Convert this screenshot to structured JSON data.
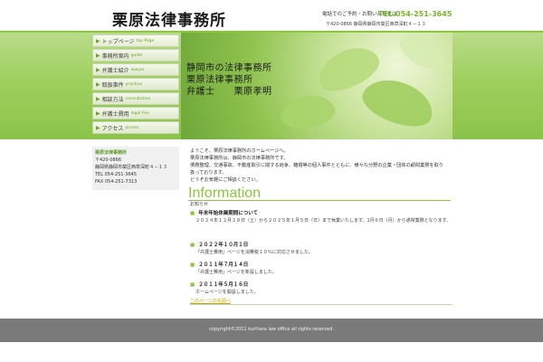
{
  "header": {
    "site_title": "栗原法律事務所",
    "contact_label": "電話でのご予約・お問い合わせは",
    "tel": "TEL.054-251-3645",
    "address": "〒420-0866 静岡県静岡市葵区西草深町４－１３"
  },
  "hero": {
    "line1": "静岡市の法律事務所",
    "line2": "栗原法律事務所",
    "line3": "弁護士　　栗原孝明"
  },
  "nav": [
    {
      "jp": "トップページ",
      "en": "top Page"
    },
    {
      "jp": "事務所案内",
      "en": "guide"
    },
    {
      "jp": "弁護士紹介",
      "en": "lawyer"
    },
    {
      "jp": "取扱事件",
      "en": "practice"
    },
    {
      "jp": "相談方法",
      "en": "consultation"
    },
    {
      "jp": "弁護士費用",
      "en": "legal Fee"
    },
    {
      "jp": "アクセス",
      "en": "access"
    }
  ],
  "sidebox": {
    "title": "栗原法律事務所",
    "zip": "〒420-0866",
    "address": "静岡県静岡市葵区西草深町４－１３",
    "tel": "TEL 054-251-3645",
    "fax": "FAX 054-251-7313"
  },
  "intro": {
    "line1": "ようこそ、栗原法律事務所のホームページへ。",
    "line2": "栗原法律事務所は、静岡市の法律事務所です。",
    "line3": "債務整理、交通事故、不動産取引に関する紛争、離婚等の個人事件とともに、様々な分野の企業・団体の顧問業務を取り扱っております。",
    "line4": "どうぞお気軽にご相談ください。"
  },
  "info": {
    "heading": "Information",
    "sub": "お知らせ",
    "items": [
      {
        "title": "年末年始休業期間について",
        "body": "２０２４年１２月２８日（土）から２０２５年１月５日（日）まで休業いたします。1月６日（月）から通常業務となります。"
      },
      {
        "title": "２０２２年１０月１日",
        "body": "「弁護士費用」ページを消費税１０％に対応させました。"
      },
      {
        "title": "２０１１年７月１４日",
        "body": "「弁護士費用」ページを新設しました。"
      },
      {
        "title": "２０１１年５月１６日",
        "body": "ホームページを開設しました。"
      }
    ],
    "to_list": "このページの先頭へ"
  },
  "footer": {
    "copyright": "copyright©2011 kurihara law office all rights reserved."
  },
  "colors": {
    "accent": "#8cc63f",
    "footer": "#7a7a7a",
    "link": "#c8a000"
  },
  "icons": {
    "nav": "arrow-right-icon",
    "bullet": "square-bullet-icon"
  }
}
